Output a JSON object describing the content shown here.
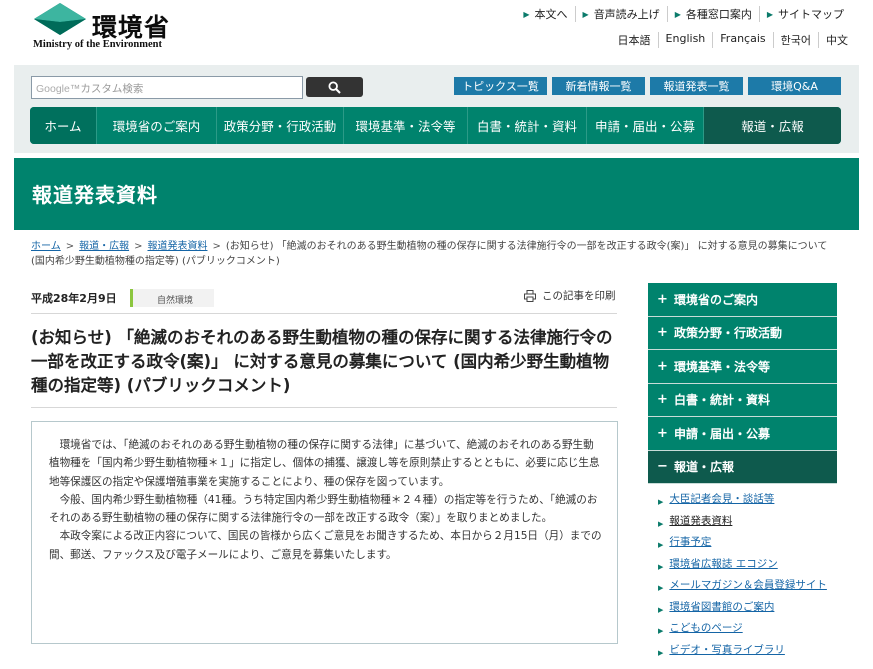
{
  "header": {
    "logo_jp": "環境省",
    "logo_en": "Ministry of the Environment",
    "util_links": [
      "本文へ",
      "音声読み上げ",
      "各種窓口案内",
      "サイトマップ"
    ],
    "lang_links": [
      "日本語",
      "English",
      "Français",
      "한국어",
      "中文"
    ]
  },
  "search": {
    "google_label": "Google™",
    "placeholder": "カスタム検索",
    "button_icon": "search-icon"
  },
  "quick_links": [
    "トピックス一覧",
    "新着情報一覧",
    "報道発表一覧",
    "環境Q&A"
  ],
  "global_nav": [
    "ホーム",
    "環境省のご案内",
    "政策分野・行政活動",
    "環境基準・法令等",
    "白書・統計・資料",
    "申請・届出・公募",
    "報道・広報"
  ],
  "page_title": "報道発表資料",
  "breadcrumb": {
    "links": [
      "ホーム",
      "報道・広報",
      "報道発表資料"
    ],
    "current": "(お知らせ) 「絶滅のおそれのある野生動植物の種の保存に関する法律施行令の一部を改正する政令(案)」 に対する意見の募集について (国内希少野生動植物種の指定等) (パブリックコメント)"
  },
  "article": {
    "date": "平成28年2月9日",
    "category": "自然環境",
    "print_label": "この記事を印刷",
    "title": "(お知らせ) 「絶滅のおそれのある野生動植物の種の保存に関する法律施行令の一部を改正する政令(案)」 に対する意見の募集について (国内希少野生動植物種の指定等) (パブリックコメント)",
    "paragraphs": [
      "環境省では、「絶滅のおそれのある野生動植物の種の保存に関する法律」に基づいて、絶滅のおそれのある野生動植物種を「国内希少野生動植物種＊１」に指定し、個体の捕獲、譲渡し等を原則禁止するとともに、必要に応じ生息地等保護区の指定や保護増殖事業を実施することにより、種の保存を図っています。",
      "今般、国内希少野生動植物種（41種。うち特定国内希少野生動植物種＊２４種）の指定等を行うため、「絶滅のおそれのある野生動植物の種の保存に関する法律施行令の一部を改正する政令（案）」を取りまとめました。",
      "本政令案による改正内容について、国民の皆様から広くご意見をお聞きするため、本日から２月15日（月）までの間、郵送、ファックス及び電子メールにより、ご意見を募集いたします。"
    ]
  },
  "side_nav": {
    "sections": [
      {
        "label": "環境省のご案内",
        "marker": "+"
      },
      {
        "label": "政策分野・行政活動",
        "marker": "+"
      },
      {
        "label": "環境基準・法令等",
        "marker": "+"
      },
      {
        "label": "白書・統計・資料",
        "marker": "+"
      },
      {
        "label": "申請・届出・公募",
        "marker": "+"
      },
      {
        "label": "報道・広報",
        "marker": "−"
      }
    ],
    "sub_items": [
      "大臣記者会見・談話等",
      "報道発表資料",
      "行事予定",
      "環境省広報誌 エコジン",
      "メールマガジン＆会員登録サイト",
      "環境省図書館のご案内",
      "こどものページ",
      "ビデオ・写真ライブラリ"
    ]
  },
  "colors": {
    "brand_green": "#00836d",
    "dark_green": "#0e5a4d",
    "quick_link_blue": "#1d7aa8",
    "link_blue": "#1565a6",
    "tag_accent": "#8cc63f"
  }
}
